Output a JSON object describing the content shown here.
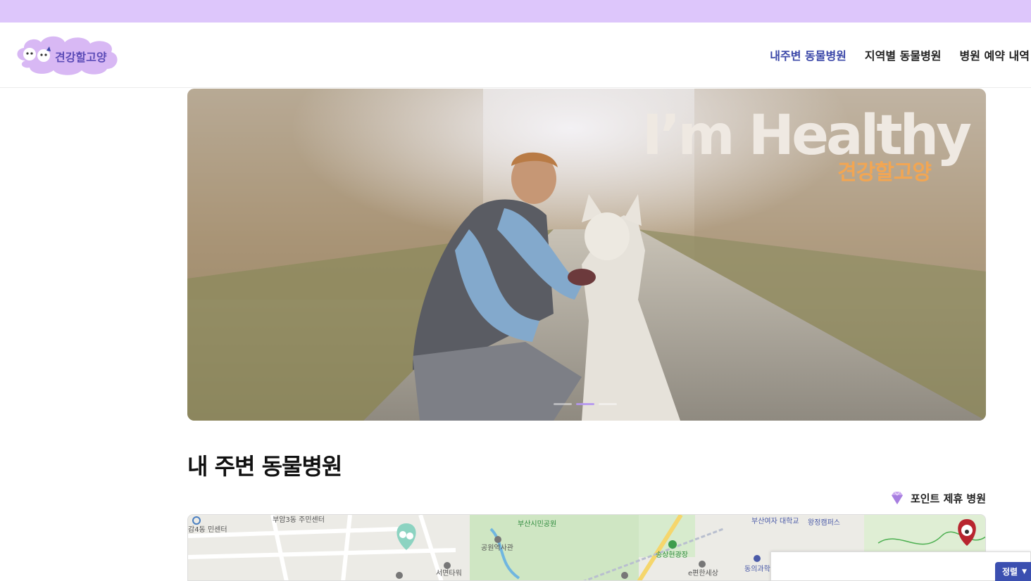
{
  "header": {
    "logo_text": "견강할고양",
    "nav": [
      {
        "label": "내주변 동물병원",
        "active": true
      },
      {
        "label": "지역별 동물병원",
        "active": false
      },
      {
        "label": "병원 예약 내역",
        "active": false
      }
    ]
  },
  "banner": {
    "title": "I’m Healthy",
    "subtitle": "견강할고양",
    "slide_count": 3,
    "active_slide": 2
  },
  "section": {
    "title": "내 주변 동물병원",
    "partner_label": "포인트 제휴 병원"
  },
  "map": {
    "labels": [
      "부암3동 주민센터",
      "부산시민공원",
      "공원역사관",
      "송상현광장",
      "부산여자 대학교",
      "동의과학 대학교",
      "e편한세상",
      "서면타워",
      "감4동 민센터",
      "왕정캠퍼스"
    ]
  },
  "panel": {
    "sort_label": "정렬"
  },
  "colors": {
    "topbar": "#ddc6fb",
    "nav_active": "#3b47a8",
    "accent_orange": "#f2a653",
    "sort_button": "#3b4fb0"
  }
}
